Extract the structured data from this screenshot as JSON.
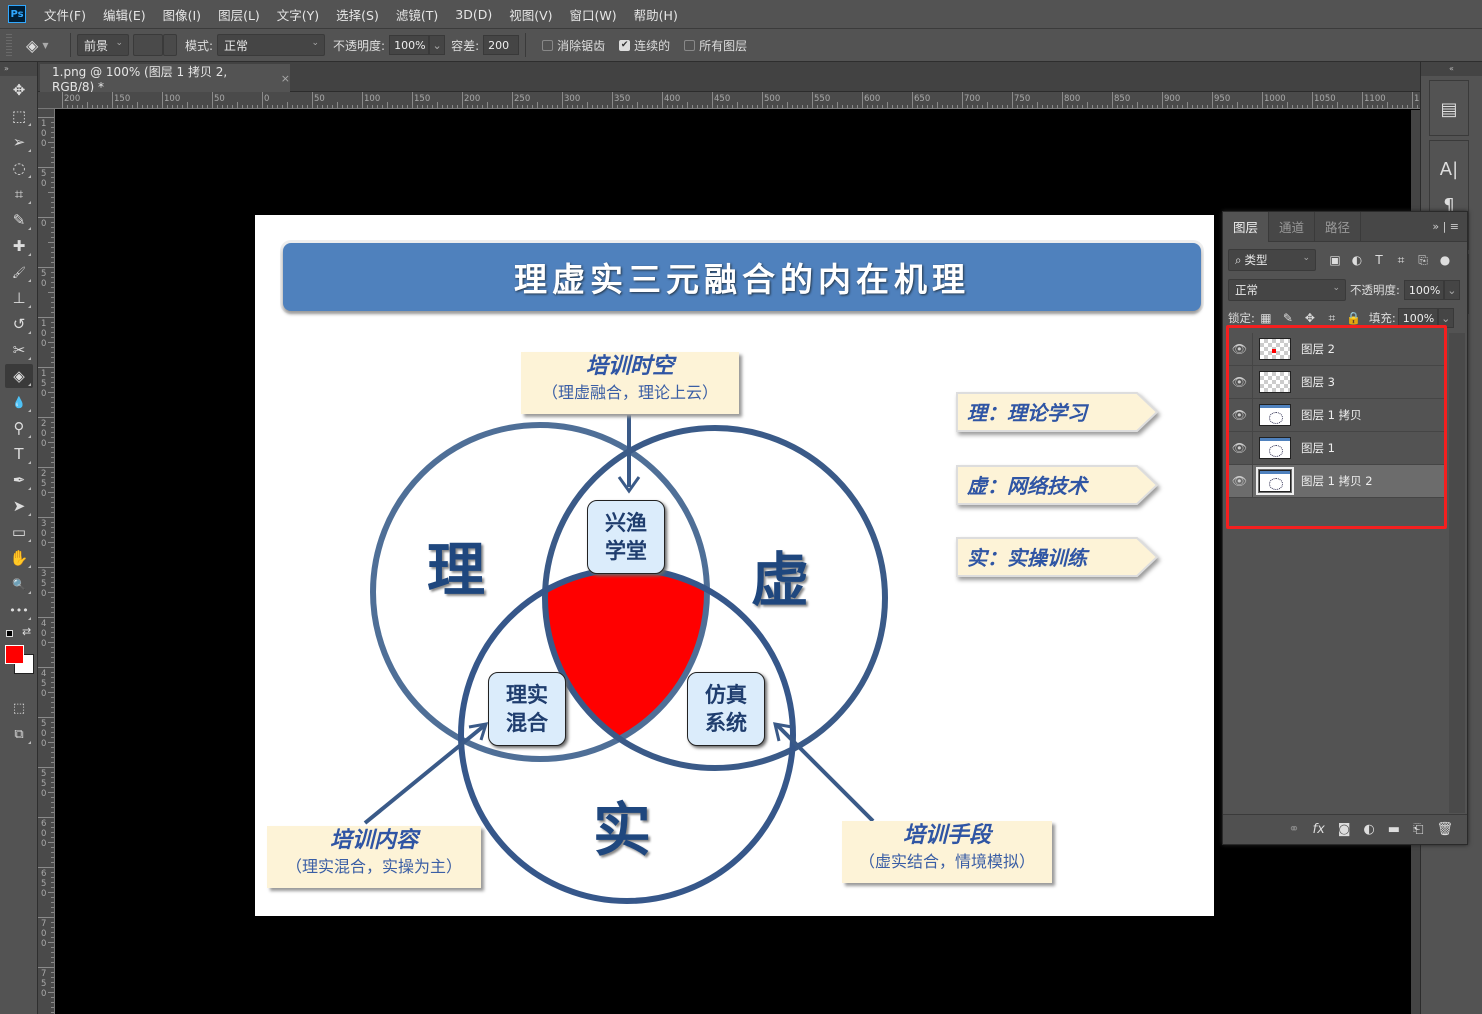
{
  "app": {
    "logo": "Ps"
  },
  "menu": [
    "文件(F)",
    "编辑(E)",
    "图像(I)",
    "图层(L)",
    "文字(Y)",
    "选择(S)",
    "滤镜(T)",
    "3D(D)",
    "视图(V)",
    "窗口(W)",
    "帮助(H)"
  ],
  "options": {
    "tool_icon": "paint-bucket-icon",
    "fill_source": "前景",
    "mode_label": "模式:",
    "mode_value": "正常",
    "opacity_label": "不透明度:",
    "opacity_value": "100%",
    "tolerance_label": "容差:",
    "tolerance_value": "200",
    "antialias_label": "消除锯齿",
    "antialias_checked": false,
    "contiguous_label": "连续的",
    "contiguous_checked": true,
    "all_layers_label": "所有图层",
    "all_layers_checked": false
  },
  "document": {
    "tab_title": "1.png @ 100% (图层 1 拷贝 2, RGB/8) *",
    "close_glyph": "×"
  },
  "rulers": {
    "horizontal": [
      "200",
      "150",
      "100",
      "50",
      "0",
      "50",
      "100",
      "150",
      "200",
      "250",
      "300",
      "350",
      "400",
      "450",
      "500",
      "550",
      "600",
      "650",
      "700",
      "750",
      "800",
      "850",
      "900",
      "950",
      "1000",
      "1050",
      "1100",
      "1"
    ],
    "vertical": [
      "100",
      "50",
      "0",
      "50",
      "100",
      "150",
      "200",
      "250",
      "300",
      "350",
      "400",
      "450",
      "500",
      "550",
      "600",
      "650",
      "700",
      "750"
    ]
  },
  "tools": [
    {
      "name": "move-tool-icon",
      "glyph": "✥"
    },
    {
      "name": "marquee-tool-icon",
      "glyph": "⬚"
    },
    {
      "name": "lasso-tool-icon",
      "glyph": "➢"
    },
    {
      "name": "quick-select-tool-icon",
      "glyph": "◌"
    },
    {
      "name": "crop-tool-icon",
      "glyph": "⌗"
    },
    {
      "name": "eyedropper-tool-icon",
      "glyph": "✎"
    },
    {
      "name": "healing-brush-tool-icon",
      "glyph": "✚"
    },
    {
      "name": "brush-tool-icon",
      "glyph": "🖌"
    },
    {
      "name": "clone-stamp-tool-icon",
      "glyph": "⊥"
    },
    {
      "name": "history-brush-tool-icon",
      "glyph": "↺"
    },
    {
      "name": "eraser-tool-icon",
      "glyph": "✂"
    },
    {
      "name": "paint-bucket-tool-icon",
      "glyph": "◈",
      "active": true
    },
    {
      "name": "blur-tool-icon",
      "glyph": "💧"
    },
    {
      "name": "dodge-tool-icon",
      "glyph": "⚲"
    },
    {
      "name": "type-tool-icon",
      "glyph": "T"
    },
    {
      "name": "pen-tool-icon",
      "glyph": "✒"
    },
    {
      "name": "path-select-tool-icon",
      "glyph": "➤"
    },
    {
      "name": "rectangle-tool-icon",
      "glyph": "▭"
    },
    {
      "name": "hand-tool-icon",
      "glyph": "✋"
    },
    {
      "name": "zoom-tool-icon",
      "glyph": "🔍"
    },
    {
      "name": "more-tools-icon",
      "glyph": "•••"
    }
  ],
  "colors": {
    "foreground": "#ff0000",
    "background": "#ffffff",
    "title_blue": "#4f81bd",
    "callout_bg": "#fdf3d7",
    "highlight_red": "#ff0000",
    "layers_frame": "#f41f1f"
  },
  "artwork": {
    "title": "理虚实三元融合的内在机理",
    "top_callout": {
      "heading": "培训时空",
      "sub": "（理虚融合，理论上云）"
    },
    "left_callout": {
      "heading": "培训内容",
      "sub": "（理实混合，实操为主）"
    },
    "right_callout": {
      "heading": "培训手段",
      "sub": "（虚实结合，情境模拟）"
    },
    "tags": [
      "理：理论学习",
      "虚：网络技术",
      "实：实操训练"
    ],
    "circles": {
      "li": "理",
      "xu": "虚",
      "shi": "实"
    },
    "boxes": {
      "top": "兴渔\n学堂",
      "left": "理实\n混合",
      "right": "仿真\n系统"
    }
  },
  "layers_panel": {
    "tabs": [
      "图层",
      "通道",
      "路径"
    ],
    "filter_label": "类型",
    "blend_mode": "正常",
    "opacity_label": "不透明度:",
    "opacity_value": "100%",
    "lock_label": "锁定:",
    "fill_label": "填充:",
    "fill_value": "100%",
    "layers": [
      {
        "name": "图层 2",
        "thumb": "transparent-red-dot",
        "visible": true,
        "selected": false
      },
      {
        "name": "图层 3",
        "thumb": "transparent",
        "visible": true,
        "selected": false
      },
      {
        "name": "图层 1 拷贝",
        "thumb": "image",
        "visible": true,
        "selected": false
      },
      {
        "name": "图层 1",
        "thumb": "image",
        "visible": true,
        "selected": false
      },
      {
        "name": "图层 1 拷贝 2",
        "thumb": "image",
        "visible": true,
        "selected": true
      }
    ]
  }
}
